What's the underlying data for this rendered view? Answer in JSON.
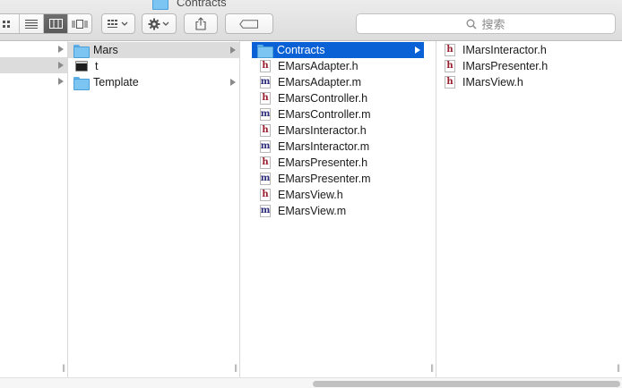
{
  "window": {
    "title": "Contracts"
  },
  "toolbar": {
    "view_icon": "icon-view-icon",
    "view_list": "list-view-icon",
    "view_columns": "column-view-icon",
    "view_coverflow": "cover-flow-icon",
    "group": "group-by-icon",
    "action": "gear-icon",
    "share": "share-icon",
    "tags": "tag-icon"
  },
  "search": {
    "placeholder": "搜索",
    "icon": "search-icon"
  },
  "column1": {
    "arrows": 3,
    "selected_row": 2
  },
  "column2": {
    "items": [
      {
        "label": "Mars",
        "type": "folder",
        "selected": true,
        "has_children": true
      },
      {
        "label": "t",
        "type": "terminal",
        "selected": false,
        "has_children": false
      },
      {
        "label": "Template",
        "type": "folder",
        "selected": false,
        "has_children": true
      }
    ]
  },
  "column3": {
    "items": [
      {
        "label": "Contracts",
        "type": "folder",
        "selected": true,
        "has_children": true
      },
      {
        "label": "EMarsAdapter.h",
        "type": "h"
      },
      {
        "label": "EMarsAdapter.m",
        "type": "m"
      },
      {
        "label": "EMarsController.h",
        "type": "h"
      },
      {
        "label": "EMarsController.m",
        "type": "m"
      },
      {
        "label": "EMarsInteractor.h",
        "type": "h"
      },
      {
        "label": "EMarsInteractor.m",
        "type": "m"
      },
      {
        "label": "EMarsPresenter.h",
        "type": "h"
      },
      {
        "label": "EMarsPresenter.m",
        "type": "m"
      },
      {
        "label": "EMarsView.h",
        "type": "h"
      },
      {
        "label": "EMarsView.m",
        "type": "m"
      }
    ]
  },
  "column4": {
    "items": [
      {
        "label": "IMarsInteractor.h",
        "type": "h"
      },
      {
        "label": "IMarsPresenter.h",
        "type": "h"
      },
      {
        "label": "IMarsView.h",
        "type": "h"
      }
    ]
  }
}
